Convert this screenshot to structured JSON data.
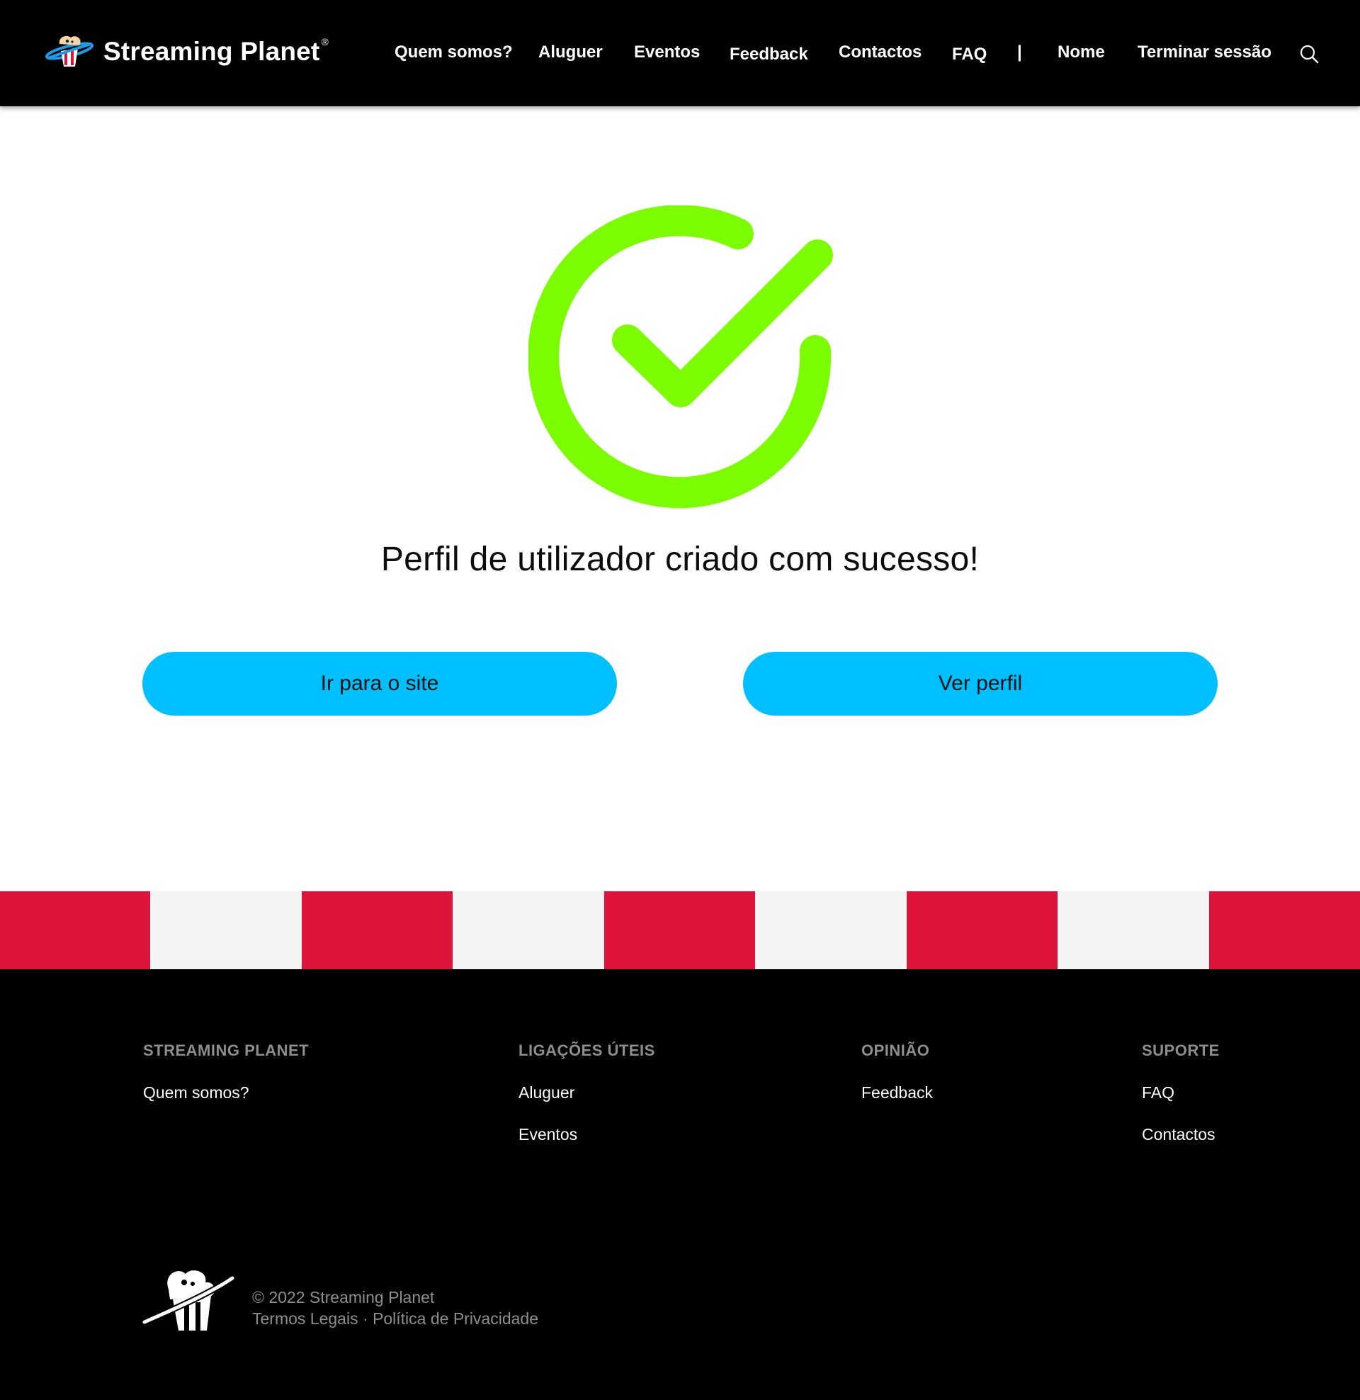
{
  "header": {
    "brand_name": "Streaming Planet",
    "brand_reg": "®",
    "nav": {
      "about": "Quem somos?",
      "rental": "Aluguer",
      "events": "Eventos",
      "feedback": "Feedback",
      "contacts": "Contactos",
      "faq": "FAQ",
      "separator": "|",
      "user": "Nome",
      "logout": "Terminar sessão"
    },
    "search_icon": "search-icon"
  },
  "main": {
    "success_icon": "check-circle-icon",
    "title": "Perfil de utilizador criado com sucesso!",
    "buttons": {
      "go_site": "Ir para o site",
      "view_profile": "Ver perfil"
    }
  },
  "stripes": {
    "colors": [
      "#dc143c",
      "#f4f4f4"
    ]
  },
  "footer": {
    "columns": {
      "brand": {
        "heading": "STREAMING PLANET",
        "links": [
          "Quem somos?"
        ]
      },
      "useful": {
        "heading": "LIGAÇÕES ÚTEIS",
        "links": [
          "Aluguer",
          "Eventos"
        ]
      },
      "opinion": {
        "heading": "OPINIÃO",
        "links": [
          "Feedback"
        ]
      },
      "support": {
        "heading": "SUPORTE",
        "links": [
          "FAQ",
          "Contactos"
        ]
      }
    },
    "copyright": "© 2022 Streaming Planet",
    "legal": {
      "terms": "Termos Legais",
      "dot": " · ",
      "privacy": "Política de Privacidade"
    }
  },
  "colors": {
    "accent": "#00bfff",
    "success": "#7cfc00",
    "stripe_red": "#dc143c",
    "stripe_light": "#f4f4f4",
    "header_bg": "#000000"
  }
}
